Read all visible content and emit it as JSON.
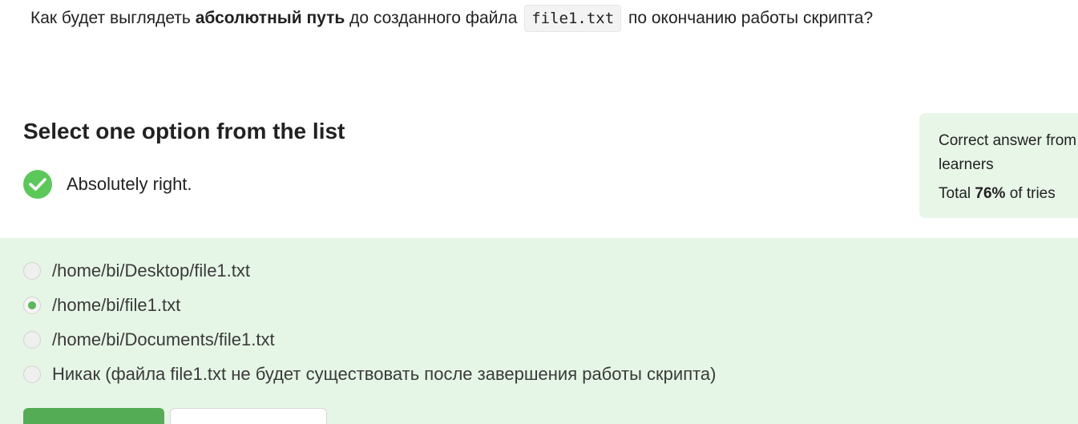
{
  "question": {
    "prefix": "Как будет выглядеть ",
    "bold": "абсолютный путь",
    "middle": " до созданного файла ",
    "code": "file1.txt",
    "suffix": " по окончанию работы скрипта?"
  },
  "select_title": "Select one option from the list",
  "result": {
    "icon": "check-circle-icon",
    "text": "Absolutely right.",
    "color": "#5cc85a"
  },
  "stats": {
    "line1": "Correct answer from",
    "line2": "learners",
    "total_prefix": "Total ",
    "total_value": "76%",
    "total_suffix": " of tries"
  },
  "options": [
    {
      "label": "/home/bi/Desktop/file1.txt",
      "selected": false
    },
    {
      "label": "/home/bi/file1.txt",
      "selected": true
    },
    {
      "label": "/home/bi/Documents/file1.txt",
      "selected": false
    },
    {
      "label": "Никак (файла file1.txt не будет существовать после завершения работы скрипта)",
      "selected": false
    }
  ],
  "colors": {
    "accent_green": "#54ad54",
    "options_background": "#e6f6e6",
    "stats_background": "#e8f6e8"
  }
}
